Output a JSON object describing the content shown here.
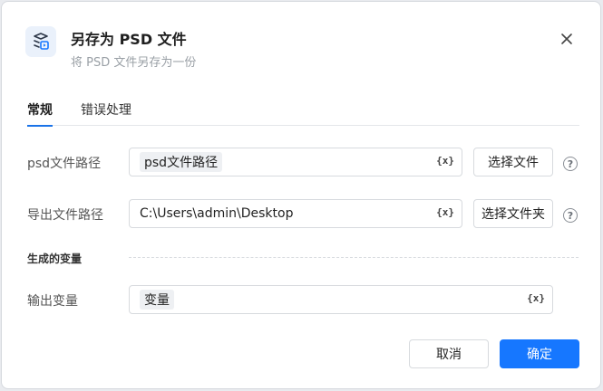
{
  "dialog": {
    "title": "另存为 PSD 文件",
    "subtitle": "将 PSD 文件另存为一份",
    "header_icon": "layers-export-icon",
    "close_icon": "close-icon"
  },
  "tabs": [
    {
      "label": "常规",
      "active": true
    },
    {
      "label": "错误处理",
      "active": false
    }
  ],
  "fields": {
    "psd_path": {
      "label": "psd文件路径",
      "value_chip": "psd文件路径",
      "button": "选择文件"
    },
    "export_path": {
      "label": "导出文件路径",
      "value": "C:\\Users\\admin\\Desktop",
      "button": "选择文件夹"
    },
    "var_icon_text": "{x}",
    "help_text": "?"
  },
  "outputs": {
    "section_title": "生成的变量",
    "output_var": {
      "label": "输出变量",
      "value_chip": "变量"
    }
  },
  "footer": {
    "cancel_label": "取消",
    "ok_label": "确定"
  },
  "colors": {
    "accent": "#1677ff",
    "tab_indicator": "#1a73e8"
  }
}
